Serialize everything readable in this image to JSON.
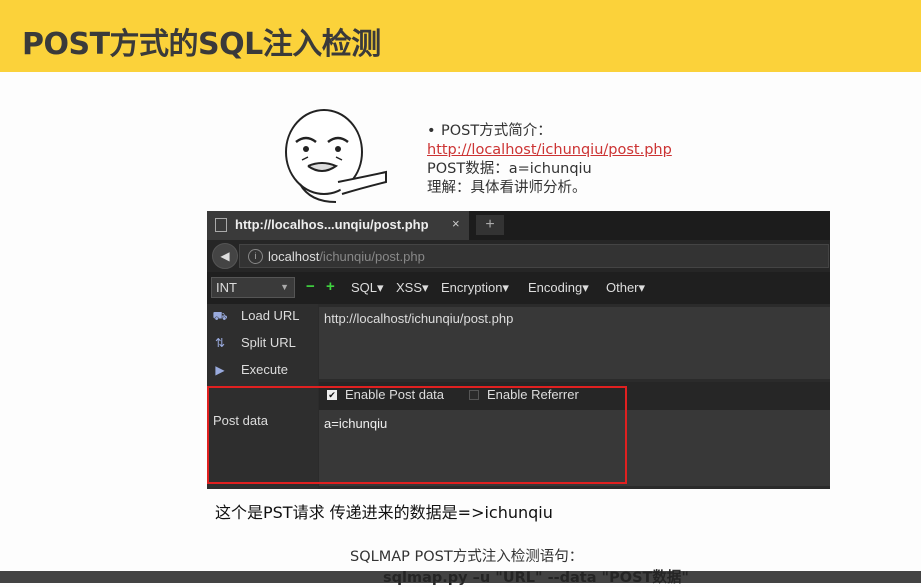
{
  "slide": {
    "title": "POST方式的SQL注入检测",
    "intro": {
      "bullet_1": "POST方式简介：",
      "link": "http://localhost/ichunqiu/post.php",
      "line_3": "POST数据：a=ichunqiu",
      "line_4": "理解：具体看讲师分析。"
    },
    "caption": "这个是PST请求 传递进来的数据是=>ichunqiu",
    "sqlmap_title": "SQLMAP POST方式注入检测语句：",
    "sqlmap_cmd": "sqlmap.py –u \"URL\" --data \"POST数据\""
  },
  "browser": {
    "tab_title": "http://localhos...unqiu/post.php",
    "tab_close": "×",
    "new_tab": "+",
    "url_host": "localhost",
    "url_path": "/ichunqiu/post.php"
  },
  "hackbar": {
    "select_value": "INT",
    "minus": "−",
    "plus": "+",
    "menus": [
      "SQL▾",
      "XSS▾",
      "Encryption▾",
      "Encoding▾",
      "Other▾"
    ],
    "load_url": "Load URL",
    "split_url": "Split URL",
    "execute": "Execute",
    "url_value": "http://localhost/ichunqiu/post.php",
    "enable_post": "Enable Post data",
    "enable_post_checked": true,
    "enable_referrer": "Enable Referrer",
    "enable_referrer_checked": false,
    "post_label": "Post data",
    "post_value": "a=ichunqiu"
  },
  "colors": {
    "header": "#fbd23a",
    "link": "#cc3333",
    "highlight": "#e02020"
  }
}
